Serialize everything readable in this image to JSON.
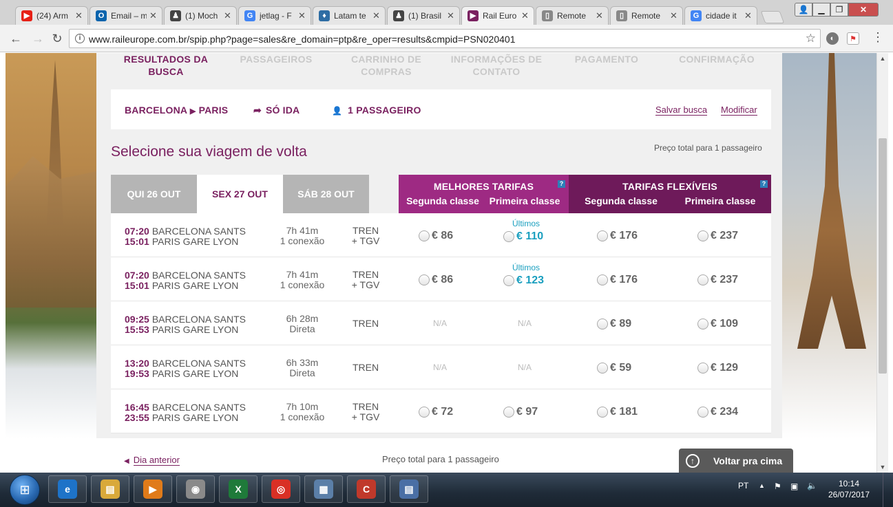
{
  "browser": {
    "tabs": [
      {
        "label": "(24) Arm",
        "icon": "youtube-icon",
        "color": "#e62117",
        "glyph": "▶"
      },
      {
        "label": "Email – m",
        "icon": "outlook-icon",
        "color": "#0a64ad",
        "glyph": "O"
      },
      {
        "label": "(1) Moch",
        "icon": "person-icon",
        "color": "#444444",
        "glyph": "♟"
      },
      {
        "label": "jetlag - F",
        "icon": "google-icon",
        "color": "#4285f4",
        "glyph": "G"
      },
      {
        "label": "Latam te",
        "icon": "pin-icon",
        "color": "#2e6da4",
        "glyph": "♦"
      },
      {
        "label": "(1) Brasil",
        "icon": "person-icon",
        "color": "#444444",
        "glyph": "♟"
      },
      {
        "label": "Rail Euro",
        "icon": "raileurope-icon",
        "color": "#7a2160",
        "glyph": "▶"
      },
      {
        "label": "Remote",
        "icon": "document-icon",
        "color": "#888888",
        "glyph": "▯"
      },
      {
        "label": "Remote",
        "icon": "document-icon",
        "color": "#888888",
        "glyph": "▯"
      },
      {
        "label": "cidade it",
        "icon": "google-icon",
        "color": "#4285f4",
        "glyph": "G"
      }
    ],
    "url": "www.raileurope.com.br/spip.php?page=sales&re_domain=ptp&re_oper=results&cmpid=PSN020401"
  },
  "steps": [
    {
      "label": "RESULTADOS DA BUSCA"
    },
    {
      "label": "PASSAGEIROS"
    },
    {
      "label": "CARRINHO DE COMPRAS"
    },
    {
      "label": "INFORMAÇÕES DE CONTATO"
    },
    {
      "label": "PAGAMENTO"
    },
    {
      "label": "CONFIRMAÇÃO"
    }
  ],
  "summary": {
    "origin": "BARCELONA",
    "destination": "PARIS",
    "trip_type": "SÓ IDA",
    "passengers": "1 PASSAGEIRO",
    "save_search": "Salvar busca",
    "modify": "Modificar"
  },
  "page_title": "Selecione sua viagem de volta",
  "total_label": "Preço total para 1 passageiro",
  "date_tabs": [
    {
      "label": "QUI 26 OUT",
      "active": false
    },
    {
      "label": "SEX 27 OUT",
      "active": true
    },
    {
      "label": "SÁB 28 OUT",
      "active": false
    }
  ],
  "fare_groups": [
    {
      "title": "MELHORES TARIFAS",
      "second": "Segunda classe",
      "first": "Primeira classe",
      "color": "#9e2a83",
      "help": "?"
    },
    {
      "title": "TARIFAS FLEXÍVEIS",
      "second": "Segunda classe",
      "first": "Primeira classe",
      "color": "#6e1a5a",
      "help": "?"
    }
  ],
  "results": [
    {
      "dep_time": "07:20",
      "dep_station": "BARCELONA SANTS",
      "arr_time": "15:01",
      "arr_station": "PARIS GARE LYON",
      "duration": "7h 41m",
      "connections": "1 conexão",
      "train1": "TREN",
      "train2": "+ TGV",
      "prices": [
        {
          "v": "€ 86"
        },
        {
          "v": "€ 110",
          "note": "Últimos",
          "hl": true
        },
        {
          "v": "€ 176"
        },
        {
          "v": "€ 237"
        }
      ]
    },
    {
      "dep_time": "07:20",
      "dep_station": "BARCELONA SANTS",
      "arr_time": "15:01",
      "arr_station": "PARIS GARE LYON",
      "duration": "7h 41m",
      "connections": "1 conexão",
      "train1": "TREN",
      "train2": "+ TGV",
      "prices": [
        {
          "v": "€ 86"
        },
        {
          "v": "€ 123",
          "note": "Últimos",
          "hl": true
        },
        {
          "v": "€ 176"
        },
        {
          "v": "€ 237"
        }
      ]
    },
    {
      "dep_time": "09:25",
      "dep_station": "BARCELONA SANTS",
      "arr_time": "15:53",
      "arr_station": "PARIS GARE LYON",
      "duration": "6h 28m",
      "connections": "Direta",
      "train1": "TREN",
      "train2": "",
      "prices": [
        {
          "na": "N/A"
        },
        {
          "na": "N/A"
        },
        {
          "v": "€ 89"
        },
        {
          "v": "€ 109"
        }
      ]
    },
    {
      "dep_time": "13:20",
      "dep_station": "BARCELONA SANTS",
      "arr_time": "19:53",
      "arr_station": "PARIS GARE LYON",
      "duration": "6h 33m",
      "connections": "Direta",
      "train1": "TREN",
      "train2": "",
      "prices": [
        {
          "na": "N/A"
        },
        {
          "na": "N/A"
        },
        {
          "v": "€ 59"
        },
        {
          "v": "€ 129"
        }
      ]
    },
    {
      "dep_time": "16:45",
      "dep_station": "BARCELONA SANTS",
      "arr_time": "23:55",
      "arr_station": "PARIS GARE LYON",
      "duration": "7h 10m",
      "connections": "1 conexão",
      "train1": "TREN",
      "train2": "+ TGV",
      "prices": [
        {
          "v": "€ 72"
        },
        {
          "v": "€ 97"
        },
        {
          "v": "€ 181"
        },
        {
          "v": "€ 234"
        }
      ]
    }
  ],
  "footer": {
    "previous_day": "Dia anterior",
    "back_to_top": "Voltar pra cima"
  },
  "taskbar": {
    "apps": [
      {
        "icon": "internet-explorer-icon",
        "glyph": "e",
        "color": "#1e73c8"
      },
      {
        "icon": "file-explorer-icon",
        "glyph": "▤",
        "color": "#d9a93a"
      },
      {
        "icon": "media-player-icon",
        "glyph": "▶",
        "color": "#e07b1a"
      },
      {
        "icon": "app-icon",
        "glyph": "◉",
        "color": "#8a8a8a"
      },
      {
        "icon": "excel-icon",
        "glyph": "X",
        "color": "#1f7a3a"
      },
      {
        "icon": "chrome-icon",
        "glyph": "◎",
        "color": "#d93025"
      },
      {
        "icon": "calculator-icon",
        "glyph": "▦",
        "color": "#5b7fa8"
      },
      {
        "icon": "ccleaner-icon",
        "glyph": "C",
        "color": "#c0392b"
      },
      {
        "icon": "notepad-icon",
        "glyph": "▤",
        "color": "#4a6fa5"
      }
    ],
    "language": "PT",
    "time": "10:14",
    "date": "26/07/2017"
  }
}
